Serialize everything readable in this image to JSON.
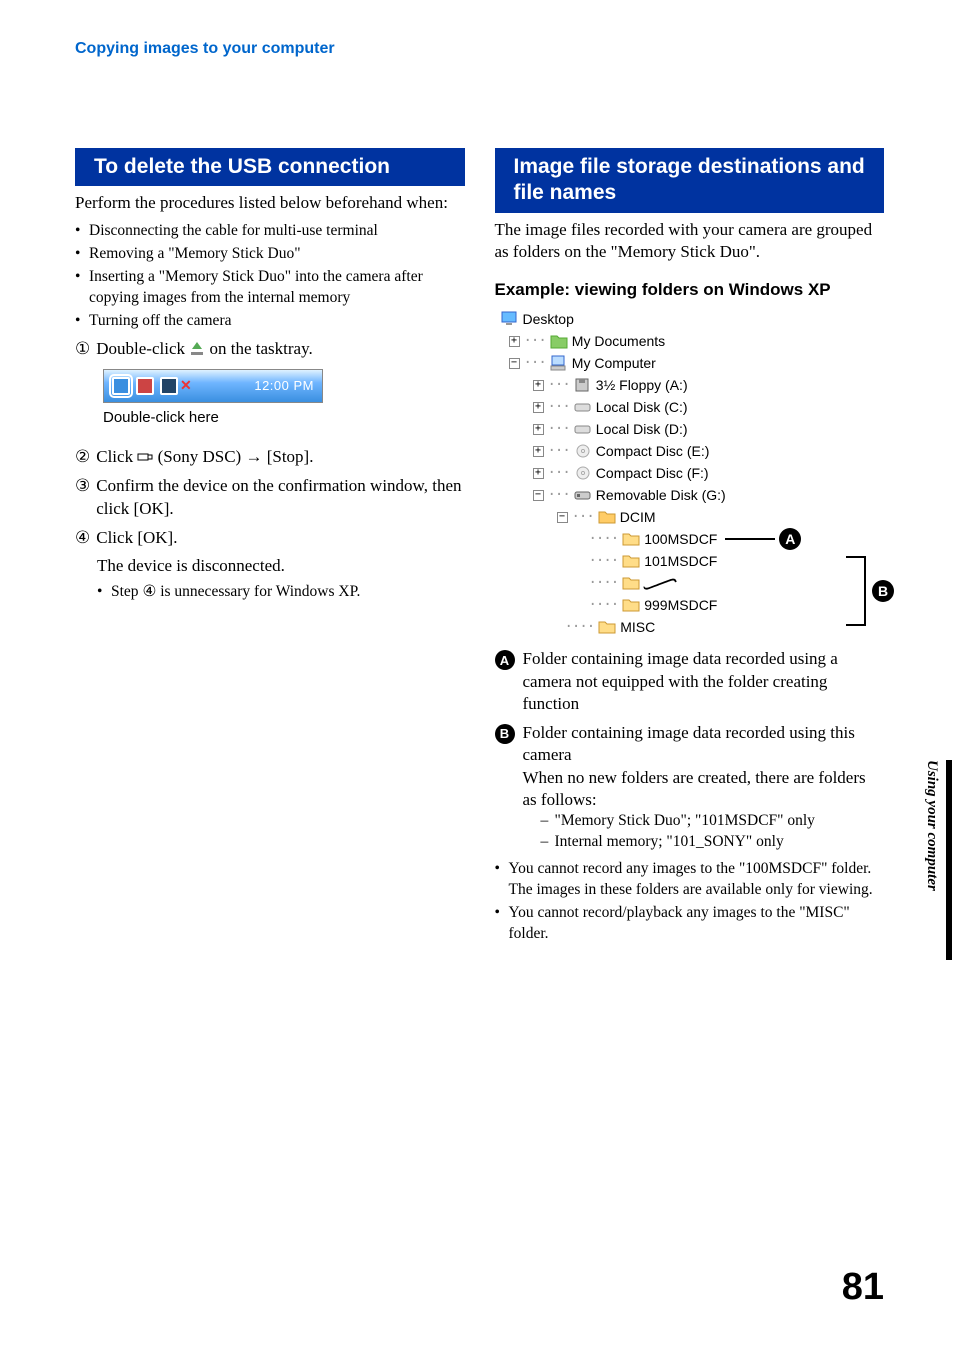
{
  "running_head": "Copying images to your computer",
  "side_tab": "Using your computer",
  "page_number": "81",
  "left": {
    "heading": "To delete the USB connection",
    "intro": "Perform the procedures listed below beforehand when:",
    "bullets": [
      "Disconnecting the cable for multi-use terminal",
      "Removing a \"Memory Stick Duo\"",
      "Inserting a \"Memory Stick Duo\" into the camera after copying images from the internal memory",
      "Turning off the camera"
    ],
    "step1_a": "Double-click ",
    "step1_b": " on the tasktray.",
    "tasktray_time": "12:00 PM",
    "tasktray_caption": "Double-click here",
    "step2_a": "Click ",
    "step2_b": " (Sony DSC) ",
    "step2_c": " [Stop].",
    "step3": "Confirm the device on the confirmation window, then click [OK].",
    "step4": "Click [OK].",
    "step4_sub": "The device is disconnected.",
    "step4_note_a": "Step ",
    "step4_note_b": " is unnecessary for Windows XP."
  },
  "right": {
    "heading": "Image file storage destinations and file names",
    "intro": "The image files recorded with your camera are grouped as folders on the \"Memory Stick Duo\".",
    "example_head": "Example: viewing folders on Windows XP",
    "tree": {
      "desktop": "Desktop",
      "mydocs": "My Documents",
      "mycomp": "My Computer",
      "floppy": "3½ Floppy (A:)",
      "c": "Local Disk (C:)",
      "d": "Local Disk (D:)",
      "e": "Compact Disc (E:)",
      "f": "Compact Disc (F:)",
      "g": "Removable Disk (G:)",
      "dcim": "DCIM",
      "f100": "100MSDCF",
      "f101": "101MSDCF",
      "f999": "999MSDCF",
      "misc": "MISC"
    },
    "legendA": "Folder containing image data recorded using a camera not equipped with the folder creating function",
    "legendB1": "Folder containing image data recorded using this camera",
    "legendB2": "When no new folders are created, there are folders as follows:",
    "legendB_dash1": "\"Memory Stick Duo\"; \"101MSDCF\" only",
    "legendB_dash2": "Internal memory; \"101_SONY\" only",
    "note1": "You cannot record any images to the \"100MSDCF\" folder. The images in these folders are available only for viewing.",
    "note2": "You cannot record/playback any images to the \"MISC\" folder."
  }
}
